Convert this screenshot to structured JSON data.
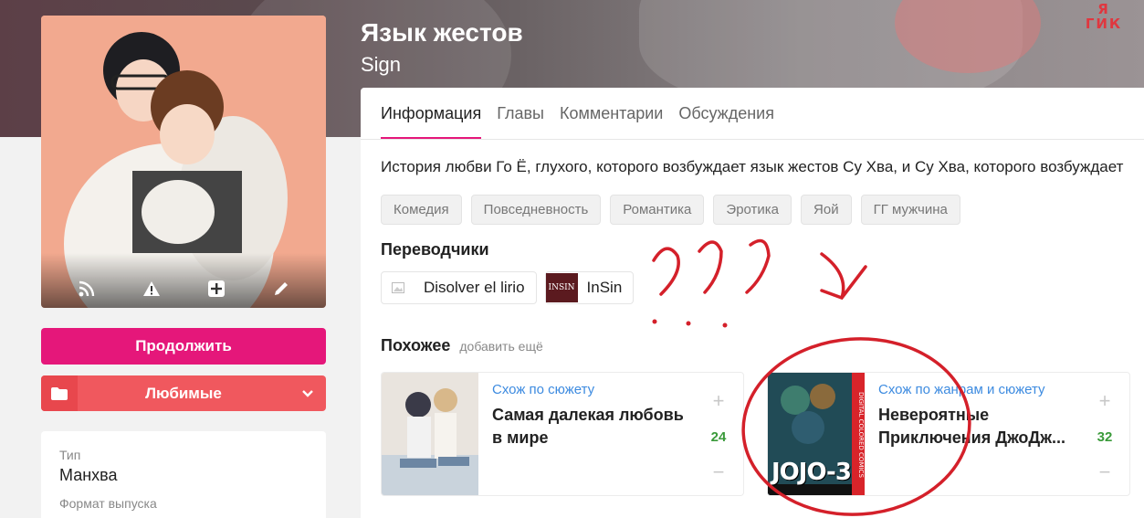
{
  "site_logo": "Я ГИК",
  "manga": {
    "title": "Язык жестов",
    "subtitle": "Sign",
    "description": "История любви Го Ё, глухого, которого возбуждает язык жестов Су Хва, и Су Хва, которого возбуждает"
  },
  "cover_actions": [
    {
      "icon": "rss-icon"
    },
    {
      "icon": "warning-icon"
    },
    {
      "icon": "plus-square-icon"
    },
    {
      "icon": "pencil-icon"
    }
  ],
  "buttons": {
    "continue": "Продолжить",
    "favorites": "Любимые"
  },
  "info": [
    {
      "label": "Тип",
      "value": "Манхва"
    },
    {
      "label": "Формат выпуска",
      "value": ""
    }
  ],
  "tabs": [
    {
      "label": "Информация",
      "active": true
    },
    {
      "label": "Главы",
      "active": false
    },
    {
      "label": "Комментарии",
      "active": false
    },
    {
      "label": "Обсуждения",
      "active": false
    }
  ],
  "genres": [
    "Комедия",
    "Повседневность",
    "Романтика",
    "Эротика",
    "Яой",
    "ГГ мужчина"
  ],
  "translators_title": "Переводчики",
  "translators": [
    {
      "name": "Disolver el lirio",
      "avatar": "image-placeholder-icon"
    },
    {
      "name": "InSin",
      "avatar_text": "INSIN"
    }
  ],
  "similar": {
    "title": "Похожее",
    "more": "добавить ещё",
    "items": [
      {
        "tag": "Схож по сюжету",
        "name": "Самая далекая любовь в мире",
        "votes": "24"
      },
      {
        "tag": "Схож по жанрам и сюжету",
        "name": "Невероятные Приключения ДжоДж...",
        "votes": "32",
        "cover_text": "JOJO-3",
        "cover_side": "DIGITAL COLORED COMICS"
      }
    ]
  },
  "colors": {
    "accent": "#e5177a",
    "favorite": "#f0585e",
    "link": "#3d8be0",
    "votes": "#3a9a3a",
    "annotation": "#d4202a"
  }
}
